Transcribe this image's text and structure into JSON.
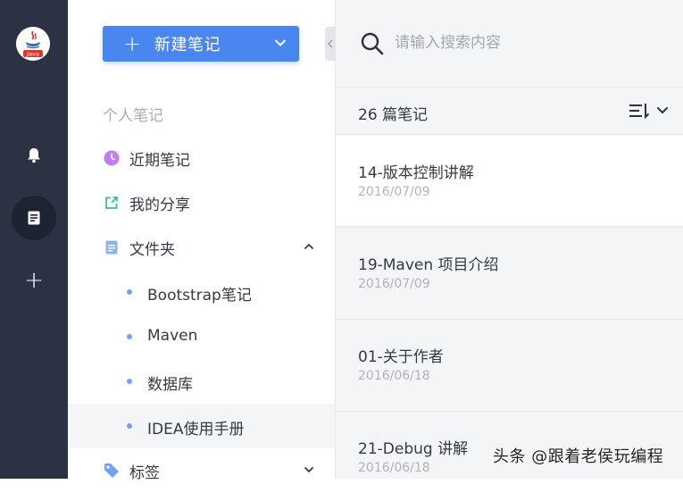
{
  "rail": {
    "logo_text": "Java",
    "items": [
      {
        "icon": "bell-icon"
      },
      {
        "icon": "note-icon",
        "active": true
      },
      {
        "icon": "plus-icon",
        "glyph": "+"
      }
    ]
  },
  "sidebar": {
    "new_note_label": "新建笔记",
    "section_title": "个人笔记",
    "items": [
      {
        "label": "近期笔记",
        "icon": "clock-icon",
        "color": "#c07ef0"
      },
      {
        "label": "我的分享",
        "icon": "share-icon",
        "color": "#36c48a"
      },
      {
        "label": "文件夹",
        "icon": "folder-icon",
        "color": "#8fb3ef"
      }
    ],
    "folders": [
      {
        "label": "Bootstrap笔记"
      },
      {
        "label": "Maven"
      },
      {
        "label": "数据库"
      },
      {
        "label": "IDEA使用手册",
        "selected": true
      }
    ],
    "tags_label": "标签"
  },
  "notes": {
    "search_placeholder": "请输入搜索内容",
    "count_label": "26 篇笔记",
    "items": [
      {
        "title": "14-版本控制讲解",
        "date": "2016/07/09"
      },
      {
        "title": "19-Maven 项目介绍",
        "date": "2016/07/09"
      },
      {
        "title": "01-关于作者",
        "date": "2016/06/18"
      },
      {
        "title": "21-Debug 讲解",
        "date": "2016/06/18"
      }
    ]
  },
  "watermark": "头条 @跟着老侯玩编程",
  "colors": {
    "rail_bg": "#2a3243",
    "accent": "#4a86f0",
    "list_bg": "#f4f5f7"
  }
}
